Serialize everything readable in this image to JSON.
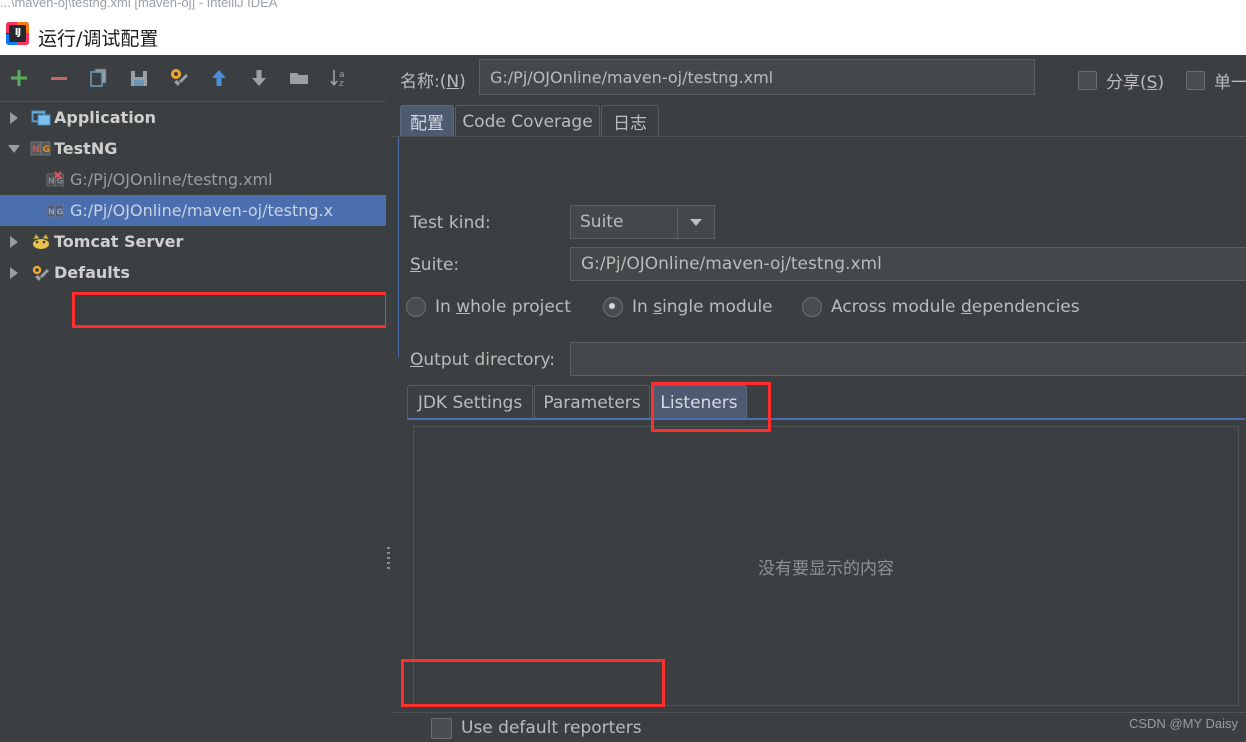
{
  "ide": {
    "window_title": "...\\maven-oj\\testng.xml [maven-oj] - IntelliJ IDEA"
  },
  "dialog": {
    "title": "运行/调试配置",
    "icon": "intellij-idea-logo",
    "icon_text": "IJ"
  },
  "toolbar": {
    "items": [
      {
        "name": "add",
        "icon": "plus-icon"
      },
      {
        "name": "remove",
        "icon": "minus-icon"
      },
      {
        "name": "copy",
        "icon": "copy-icon"
      },
      {
        "name": "save",
        "icon": "save-icon"
      },
      {
        "name": "edit-defaults",
        "icon": "wrench-icon"
      },
      {
        "name": "move-up",
        "icon": "arrow-up-icon"
      },
      {
        "name": "move-down",
        "icon": "arrow-down-icon"
      },
      {
        "name": "new-folder",
        "icon": "folder-icon"
      },
      {
        "name": "sort-alphabetically",
        "icon": "sort-az-icon"
      }
    ]
  },
  "tree": {
    "nodes": [
      {
        "label": "Application",
        "icon": "application-icon",
        "expanded": false,
        "bold": true,
        "indent": false,
        "selected": false
      },
      {
        "label": "TestNG",
        "icon": "testng-icon",
        "expanded": true,
        "bold": true,
        "indent": false,
        "selected": false
      },
      {
        "label": "G:/Pj/OJOnline/testng.xml",
        "icon": "testng-error-icon",
        "expanded": null,
        "bold": false,
        "indent": true,
        "selected": false
      },
      {
        "label": "G:/Pj/OJOnline/maven-oj/testng.x",
        "icon": "testng-icon",
        "expanded": null,
        "bold": false,
        "indent": true,
        "selected": true
      },
      {
        "label": "Tomcat Server",
        "icon": "tomcat-icon",
        "expanded": false,
        "bold": true,
        "indent": false,
        "selected": false
      },
      {
        "label": "Defaults",
        "icon": "defaults-icon",
        "expanded": false,
        "bold": true,
        "indent": false,
        "selected": false
      }
    ]
  },
  "header": {
    "name_label_prefix": "名称:(",
    "name_label_mnemonic": "N",
    "name_label_suffix": ")",
    "name_value": "G:/Pj/OJOnline/maven-oj/testng.xml",
    "share_prefix": "分享(",
    "share_mnemonic": "S",
    "share_suffix": ")",
    "share_checked": false,
    "single_prefix": "单一",
    "single_checked": false
  },
  "tabs": [
    {
      "label": "配置",
      "active": true
    },
    {
      "label": "Code Coverage",
      "active": false
    },
    {
      "label": "日志",
      "active": false
    }
  ],
  "form": {
    "test_kind_label": "Test kind:",
    "test_kind_value": "Suite",
    "suite_label_mnemonic": "S",
    "suite_label_rest": "uite:",
    "suite_value": "G:/Pj/OJOnline/maven-oj/testng.xml",
    "output_label_mnemonic": "O",
    "output_label_rest": "utput directory:",
    "output_value": "",
    "scope": [
      {
        "pre": "In ",
        "mnemonic": "w",
        "post": "hole project",
        "selected": false
      },
      {
        "pre": "In ",
        "mnemonic": "s",
        "post": "ingle module",
        "selected": true
      },
      {
        "pre": "Across module ",
        "mnemonic": "d",
        "post": "ependencies",
        "selected": false
      }
    ]
  },
  "inner_tabs": [
    {
      "label": "JDK Settings",
      "active": false
    },
    {
      "label": "Parameters",
      "active": false
    },
    {
      "label": "Listeners",
      "active": true
    }
  ],
  "listeners_panel": {
    "empty_text": "没有要显示的内容",
    "use_default_reporters_label": "Use default reporters",
    "use_default_reporters_checked": false
  },
  "watermark": "CSDN @MY Daisy",
  "colors": {
    "background": "#3c3f41",
    "selection_blue": "#4b6eaf",
    "tab_active": "#4e5a70",
    "annotation_red": "#ff2f2f",
    "text": "#bbbbbb"
  }
}
